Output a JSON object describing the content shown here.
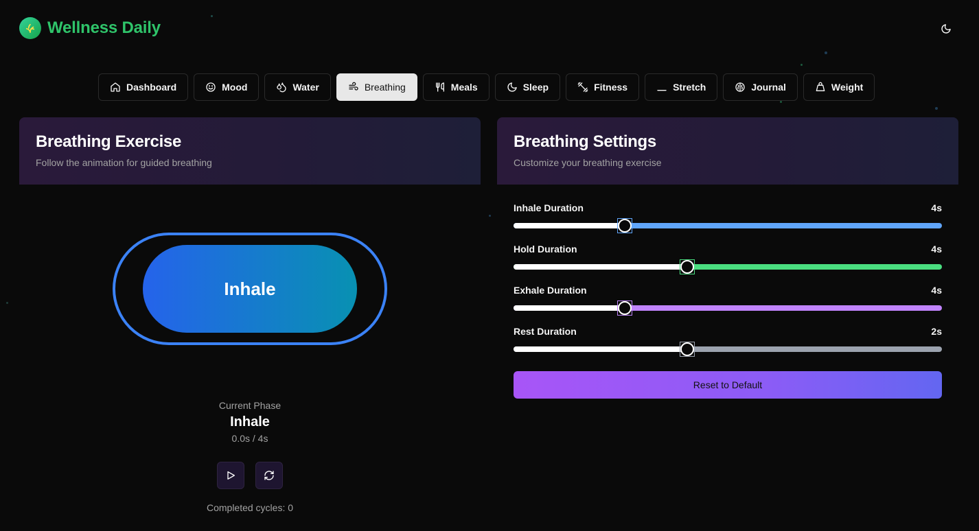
{
  "app": {
    "title": "Wellness Daily",
    "brand_color": "#2fc46a"
  },
  "header": {
    "theme_toggle_icon": "moon-icon"
  },
  "nav": {
    "active": "Breathing",
    "tabs": [
      {
        "label": "Dashboard",
        "icon": "home-icon"
      },
      {
        "label": "Mood",
        "icon": "smile-icon"
      },
      {
        "label": "Water",
        "icon": "droplets-icon"
      },
      {
        "label": "Breathing",
        "icon": "wind-icon"
      },
      {
        "label": "Meals",
        "icon": "utensils-icon"
      },
      {
        "label": "Sleep",
        "icon": "moon-icon"
      },
      {
        "label": "Fitness",
        "icon": "dumbbell-icon"
      },
      {
        "label": "Stretch",
        "icon": "stretch-icon"
      },
      {
        "label": "Journal",
        "icon": "brain-icon"
      },
      {
        "label": "Weight",
        "icon": "weight-icon"
      }
    ]
  },
  "exercise": {
    "title": "Breathing Exercise",
    "subtitle": "Follow the animation for guided breathing",
    "circle_label": "Inhale",
    "phase_label": "Current Phase",
    "phase_value": "Inhale",
    "timer": "0.0s / 4s",
    "play_icon": "play-icon",
    "reset_icon": "refresh-icon",
    "cycles_text": "Completed cycles: 0"
  },
  "settings": {
    "title": "Breathing Settings",
    "subtitle": "Customize your breathing exercise",
    "items": [
      {
        "label": "Inhale Duration",
        "value": "4s",
        "fraction": 0.26,
        "color": "#60a5fa"
      },
      {
        "label": "Hold Duration",
        "value": "4s",
        "fraction": 0.405,
        "color": "#4ade80"
      },
      {
        "label": "Exhale Duration",
        "value": "4s",
        "fraction": 0.26,
        "color": "#c084fc"
      },
      {
        "label": "Rest Duration",
        "value": "2s",
        "fraction": 0.405,
        "color": "#9ca3af"
      }
    ],
    "reset_label": "Reset to Default"
  }
}
